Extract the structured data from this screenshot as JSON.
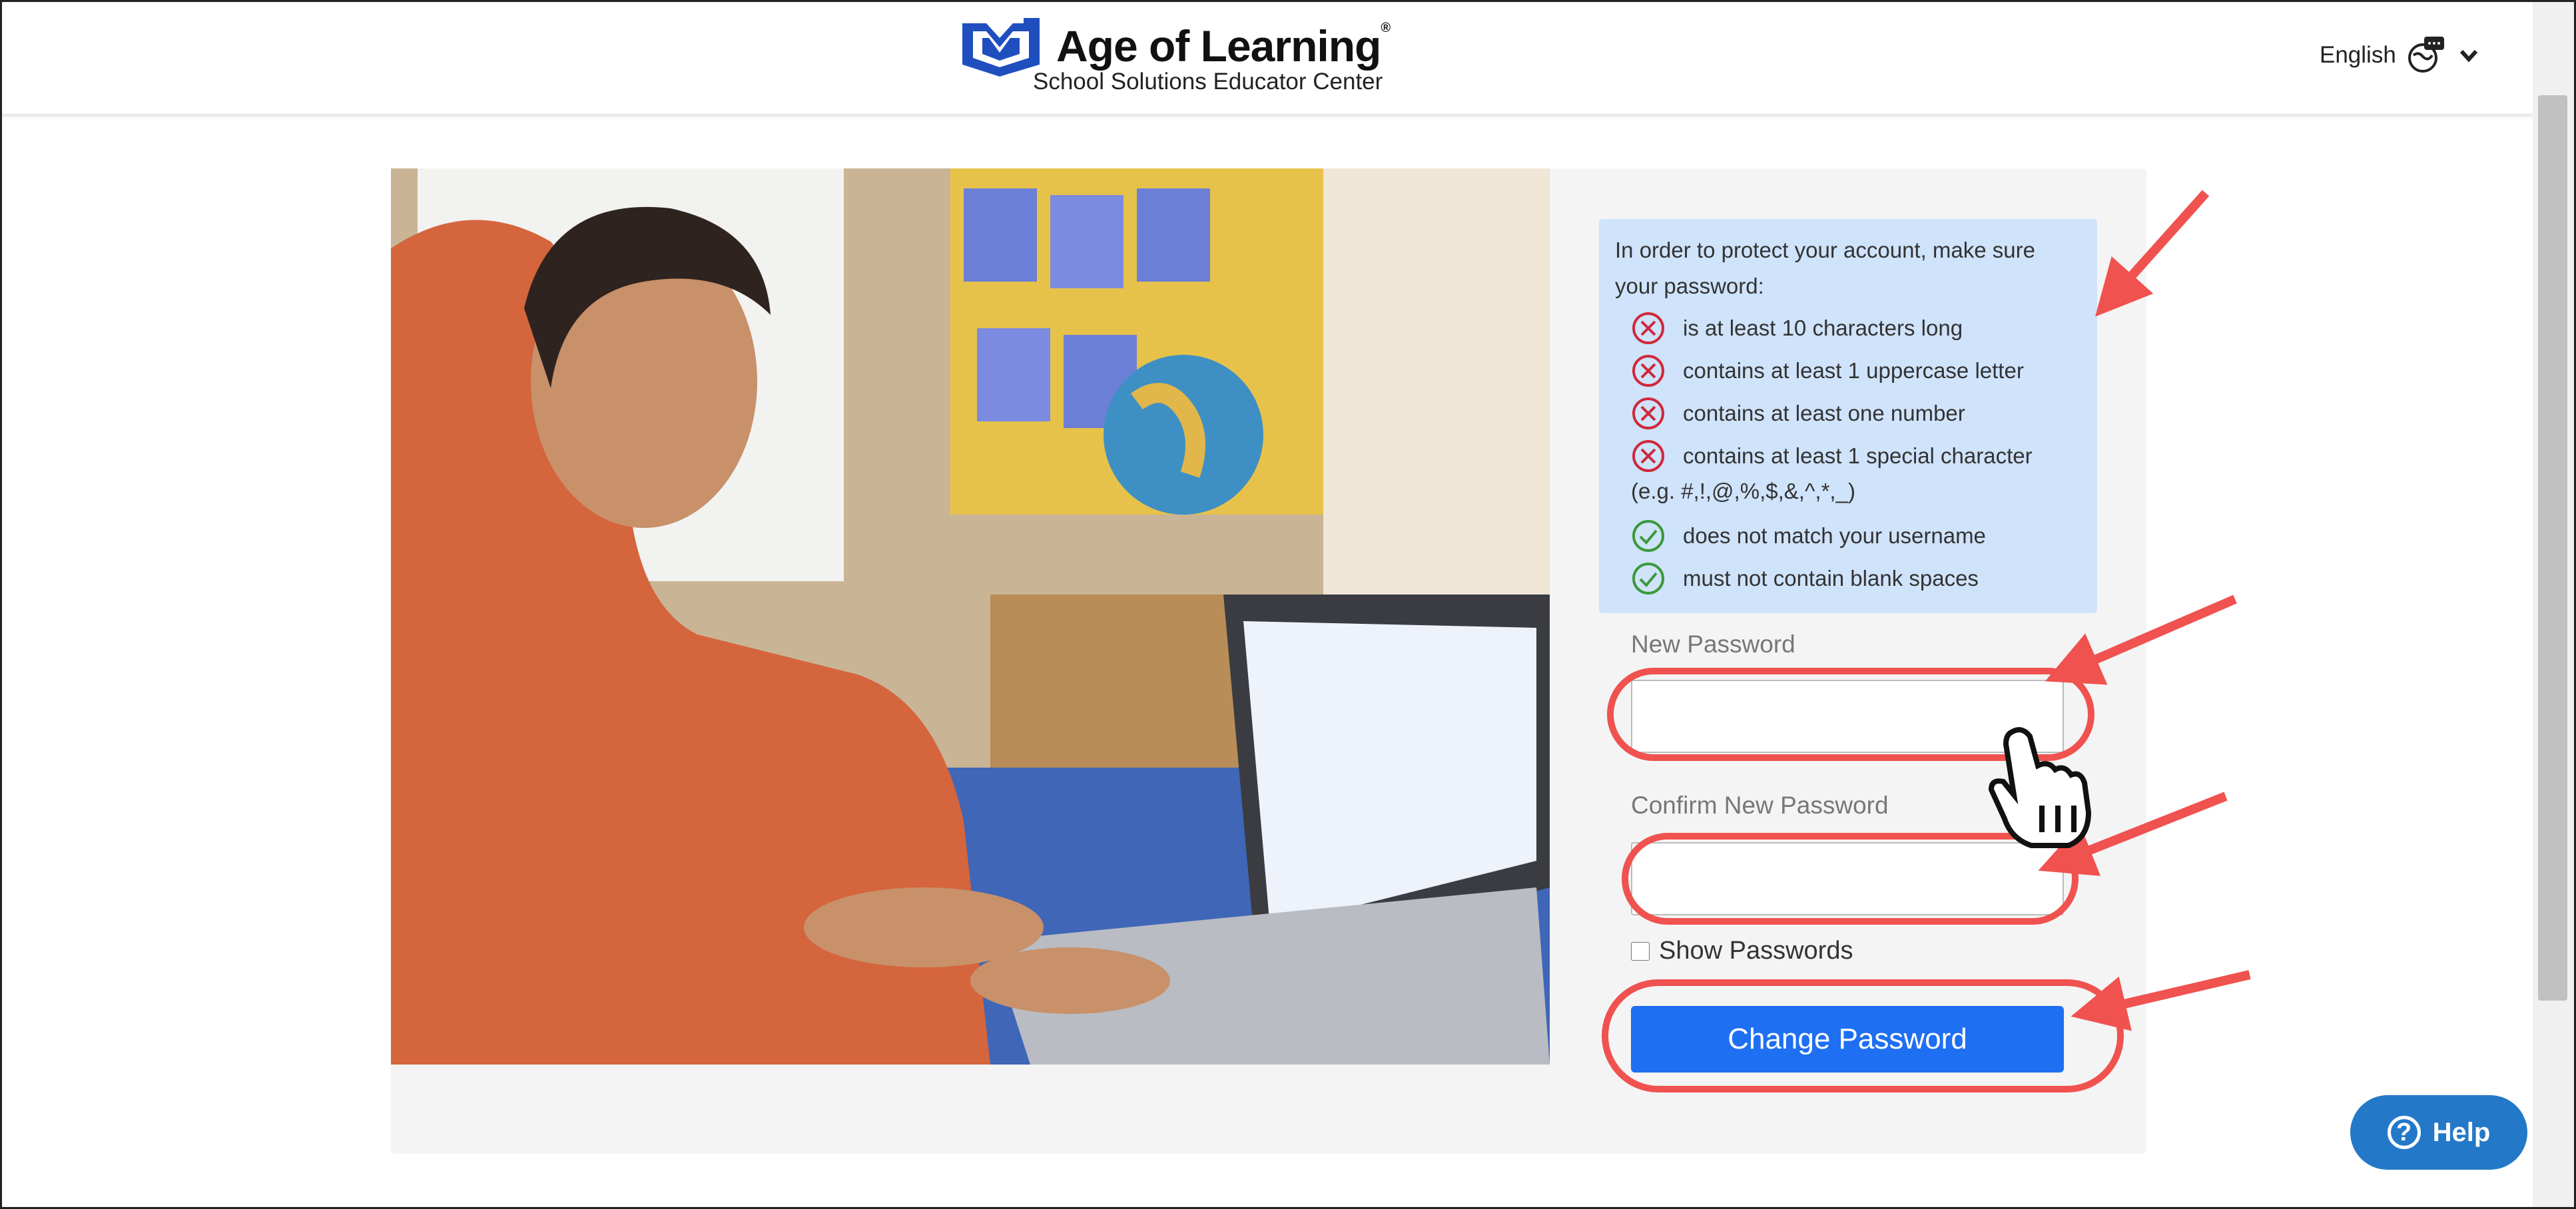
{
  "header": {
    "brand_name": "Age of Learning",
    "brand_mark": "®",
    "subtitle": "School Solutions Educator Center",
    "language": "English"
  },
  "requirements": {
    "intro": "In order to protect your account, make sure your password:",
    "items": [
      {
        "text": "is at least 10 characters long",
        "status": "fail"
      },
      {
        "text": "contains at least 1 uppercase letter",
        "status": "fail"
      },
      {
        "text": "contains at least one number",
        "status": "fail"
      },
      {
        "text": "contains at least 1 special character",
        "status": "fail"
      },
      {
        "text": "does not match your username",
        "status": "pass"
      },
      {
        "text": "must not contain blank spaces",
        "status": "pass"
      }
    ],
    "special_examples": "(e.g. #,!,@,%,$,&,^,*,_)"
  },
  "form": {
    "new_password_label": "New Password",
    "new_password_value": "",
    "confirm_password_label": "Confirm New Password",
    "confirm_password_value": "",
    "show_passwords_label": "Show Passwords",
    "show_passwords_checked": false,
    "submit_label": "Change Password"
  },
  "help": {
    "label": "Help"
  },
  "colors": {
    "primary_button": "#1f6ff2",
    "help_button": "#2379c8",
    "requirements_bg": "#cfe3fb",
    "fail": "#d0283a",
    "pass": "#3a9a3a",
    "annotation": "#f0524f"
  },
  "icons": {
    "logo": "age-of-learning-logo-icon",
    "language": "language-globe-icon",
    "fail": "x-circle-icon",
    "pass": "check-circle-icon",
    "help": "question-circle-icon",
    "cursor": "hand-pointer-icon"
  }
}
